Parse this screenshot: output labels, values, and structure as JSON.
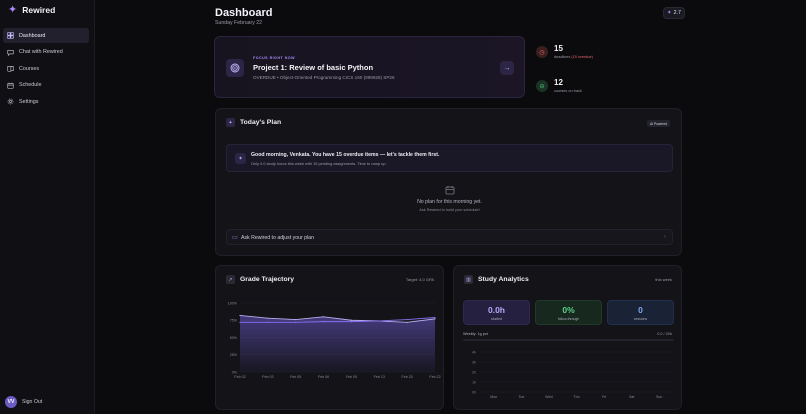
{
  "app": {
    "name": "Rewired"
  },
  "sidebar": {
    "items": [
      {
        "label": "Dashboard",
        "icon": "grid-icon",
        "active": true
      },
      {
        "label": "Chat with Rewired",
        "icon": "chat-icon",
        "active": false
      },
      {
        "label": "Courses",
        "icon": "book-icon",
        "active": false
      },
      {
        "label": "Schedule",
        "icon": "calendar-icon",
        "active": false
      },
      {
        "label": "Settings",
        "icon": "gear-icon",
        "active": false
      }
    ],
    "user_initials": "VV",
    "signout_label": "Sign Out"
  },
  "header": {
    "title": "Dashboard",
    "date": "Sunday February 22",
    "streak_value": "2.7"
  },
  "focus": {
    "label": "FOCUS RIGHT NOW",
    "title": "Project 1: Review of basic Python",
    "course": "OVERDUE • Object-Oriented Programming CICS 160 (999929) SP26"
  },
  "stats": [
    {
      "value": "15",
      "prefix": "deadlines",
      "highlight": "(15 overdue)",
      "icon": "alert-icon",
      "color": "#e36a6a"
    },
    {
      "value": "12",
      "prefix": "courses on track",
      "highlight": "",
      "icon": "check-icon",
      "color": "#4fbf7a"
    }
  ],
  "plan": {
    "title": "Today's Plan",
    "badge": "AI Powered",
    "greeting": "Good morning, Venkata. You have 15 overdue items — let's tackle them first.",
    "greeting_sub": "Only 0.0 study hours this week with 15 pending assignments. Time to ramp up.",
    "empty_title": "No plan for this morning yet.",
    "empty_sub": "Ask Rewired to build your schedule!",
    "ask_label": "Ask Rewired to adjust your plan"
  },
  "grade": {
    "title": "Grade Trajectory",
    "target": "Target: 4.0 GPA"
  },
  "analytics": {
    "title": "Study Analytics",
    "period": "this week",
    "tiles": [
      {
        "value": "0.0h",
        "label": "studied"
      },
      {
        "value": "0%",
        "label": "follow-through"
      },
      {
        "value": "0",
        "label": "sessions"
      }
    ],
    "weekly_label": "Weekly: 1g pct",
    "weekly_value": "0.0 / 20h",
    "weekly_progress": 0
  },
  "chart_data": [
    {
      "type": "area",
      "x": [
        "Feb 02",
        "Feb 03",
        "Feb 05",
        "Feb 06",
        "Feb 09",
        "Feb 13",
        "Feb 20",
        "Feb 22"
      ],
      "series": [
        {
          "values": [
            82,
            78,
            76,
            80,
            75,
            74,
            72,
            77
          ]
        },
        {
          "values": [
            72,
            72,
            72,
            73,
            73,
            74,
            76,
            79
          ]
        }
      ],
      "yticks": [
        "100%",
        "75%",
        "50%",
        "25%",
        "0%"
      ],
      "ylim": [
        0,
        100
      ],
      "grid": true
    },
    {
      "type": "bar",
      "categories": [
        "Mon",
        "Tue",
        "Wed",
        "Thu",
        "Fri",
        "Sat",
        "Sun"
      ],
      "values": [
        0,
        0,
        0,
        0,
        0,
        0,
        0
      ],
      "yticks": [
        "4h",
        "3h",
        "2h",
        "1h",
        "0h"
      ],
      "ylim": [
        0,
        4
      ],
      "grid": true
    }
  ]
}
